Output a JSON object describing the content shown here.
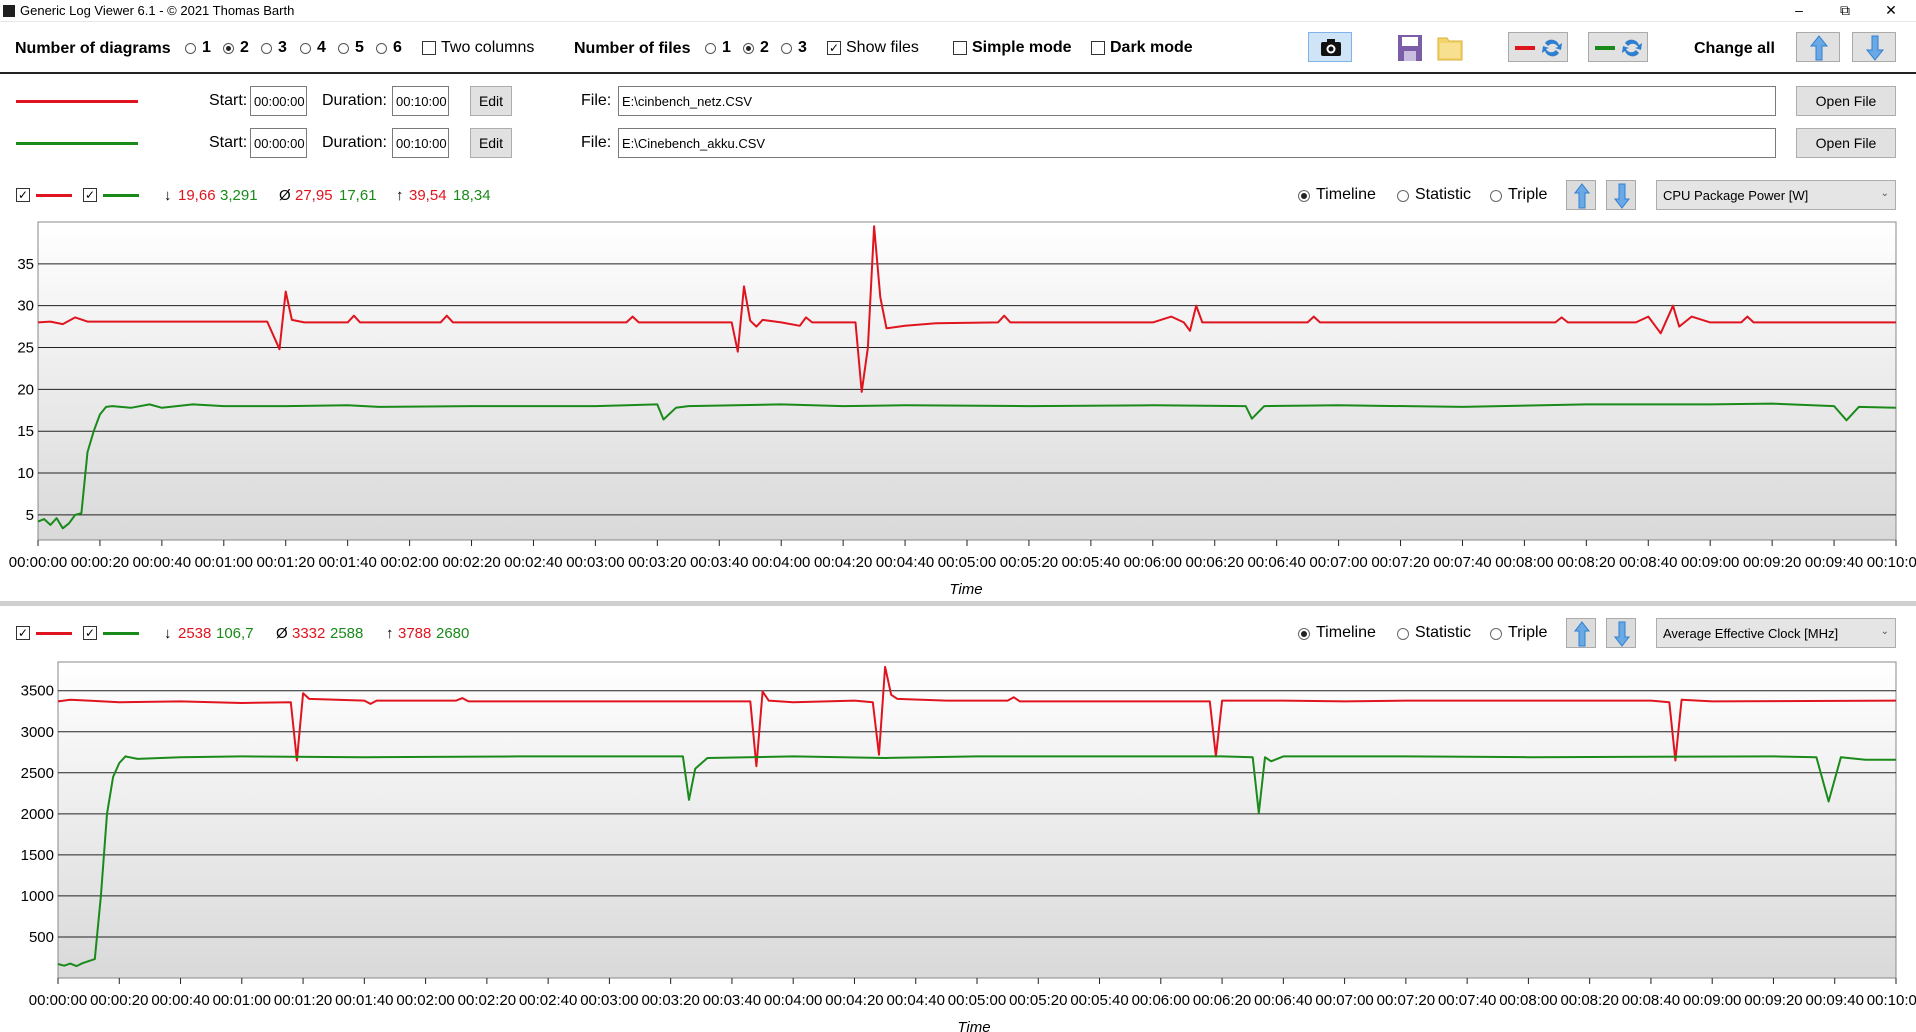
{
  "window": {
    "title": "Generic Log Viewer 6.1 - © 2021 Thomas Barth",
    "minimize_glyph": "–",
    "maximize_glyph": "⧉",
    "close_glyph": "✕"
  },
  "toolbar": {
    "num_diagrams_label": "Number of diagrams",
    "diagram_options": [
      "1",
      "2",
      "3",
      "4",
      "5",
      "6"
    ],
    "diagram_selected": "2",
    "two_columns_label": "Two columns",
    "two_columns_checked": false,
    "num_files_label": "Number of files",
    "file_options": [
      "1",
      "2",
      "3"
    ],
    "file_selected": "2",
    "show_files_label": "Show files",
    "show_files_checked": true,
    "simple_mode_label": "Simple mode",
    "dark_mode_label": "Dark mode",
    "change_all_label": "Change all",
    "icons": [
      "camera-icon",
      "save-icon",
      "folder-icon",
      "swap-red-icon",
      "swap-green-icon",
      "arrow-up-icon",
      "arrow-down-icon"
    ]
  },
  "files": [
    {
      "color": "#e0141e",
      "start_label": "Start:",
      "start": "00:00:00",
      "duration_label": "Duration:",
      "duration": "00:10:00",
      "edit_label": "Edit",
      "file_label": "File:",
      "path": "E:\\cinbench_netz.CSV",
      "open_label": "Open File"
    },
    {
      "color": "#1a8a1a",
      "start_label": "Start:",
      "start": "00:00:00",
      "duration_label": "Duration:",
      "duration": "00:10:00",
      "edit_label": "Edit",
      "file_label": "File:",
      "path": "E:\\Cinebench_akku.CSV",
      "open_label": "Open File"
    }
  ],
  "diagrams": [
    {
      "stats": {
        "min_red": "19,66",
        "min_green": "3,291",
        "avg_red": "27,95",
        "avg_green": "17,61",
        "max_red": "39,54",
        "max_green": "18,34"
      },
      "view_modes": [
        "Timeline",
        "Statistic",
        "Triple"
      ],
      "view_selected": "Timeline",
      "sensor": "CPU Package Power [W]",
      "xlabel": "Time"
    },
    {
      "stats": {
        "min_red": "2538",
        "min_green": "106,7",
        "avg_red": "3332",
        "avg_green": "2588",
        "max_red": "3788",
        "max_green": "2680"
      },
      "view_modes": [
        "Timeline",
        "Statistic",
        "Triple"
      ],
      "view_selected": "Timeline",
      "sensor": "Average Effective Clock [MHz]",
      "xlabel": "Time"
    }
  ],
  "stat_glyphs": {
    "min": "↓",
    "avg": "Ø",
    "max": "↑"
  },
  "chart_data": [
    {
      "type": "line",
      "xlabel": "Time",
      "ylabel": "",
      "ylim": [
        2,
        40
      ],
      "yticks": [
        5,
        10,
        15,
        20,
        25,
        30,
        35
      ],
      "xticks": [
        "00:00:00",
        "00:00:20",
        "00:00:40",
        "00:01:00",
        "00:01:20",
        "00:01:40",
        "00:02:00",
        "00:02:20",
        "00:02:40",
        "00:03:00",
        "00:03:20",
        "00:03:40",
        "00:04:00",
        "00:04:20",
        "00:04:40",
        "00:05:00",
        "00:05:20",
        "00:05:40",
        "00:06:00",
        "00:06:20",
        "00:06:40",
        "00:07:00",
        "00:07:20",
        "00:07:40",
        "00:08:00",
        "00:08:20",
        "00:08:40",
        "00:09:00",
        "00:09:20",
        "00:09:40",
        "00:10:00"
      ],
      "x_unit_seconds": [
        0,
        600
      ],
      "series": [
        {
          "color": "#e0141e",
          "points": [
            [
              0,
              28
            ],
            [
              4,
              28.1
            ],
            [
              8,
              27.8
            ],
            [
              12,
              28.6
            ],
            [
              16,
              28.1
            ],
            [
              30,
              28.1
            ],
            [
              50,
              28.1
            ],
            [
              74,
              28.1
            ],
            [
              78,
              24.8
            ],
            [
              80,
              31.7
            ],
            [
              82,
              28.3
            ],
            [
              86,
              28
            ],
            [
              100,
              28
            ],
            [
              102,
              28.8
            ],
            [
              104,
              28
            ],
            [
              130,
              28
            ],
            [
              132,
              28.8
            ],
            [
              134,
              28
            ],
            [
              190,
              28
            ],
            [
              192,
              28.7
            ],
            [
              194,
              28
            ],
            [
              224,
              28
            ],
            [
              226,
              24.5
            ],
            [
              228,
              32.3
            ],
            [
              230,
              28.2
            ],
            [
              232,
              27.5
            ],
            [
              234,
              28.3
            ],
            [
              240,
              28
            ],
            [
              246,
              27.6
            ],
            [
              248,
              28.6
            ],
            [
              250,
              28
            ],
            [
              264,
              28
            ],
            [
              266,
              19.7
            ],
            [
              268,
              25
            ],
            [
              270,
              39.5
            ],
            [
              272,
              31
            ],
            [
              274,
              27.3
            ],
            [
              280,
              27.6
            ],
            [
              290,
              27.9
            ],
            [
              310,
              28
            ],
            [
              312,
              28.8
            ],
            [
              314,
              28
            ],
            [
              360,
              28
            ],
            [
              366,
              28.7
            ],
            [
              370,
              28
            ],
            [
              372,
              27
            ],
            [
              374,
              30
            ],
            [
              376,
              28
            ],
            [
              410,
              28
            ],
            [
              412,
              28.7
            ],
            [
              414,
              28
            ],
            [
              490,
              28
            ],
            [
              492,
              28.6
            ],
            [
              494,
              28
            ],
            [
              516,
              28
            ],
            [
              520,
              28.7
            ],
            [
              524,
              26.7
            ],
            [
              528,
              30
            ],
            [
              530,
              27.5
            ],
            [
              534,
              28.7
            ],
            [
              540,
              28
            ],
            [
              550,
              28
            ],
            [
              552,
              28.7
            ],
            [
              554,
              28
            ],
            [
              600,
              28
            ]
          ]
        },
        {
          "color": "#1a8a1a",
          "points": [
            [
              0,
              4.2
            ],
            [
              2,
              4.5
            ],
            [
              4,
              3.8
            ],
            [
              6,
              4.6
            ],
            [
              8,
              3.4
            ],
            [
              10,
              4
            ],
            [
              12,
              5
            ],
            [
              14,
              5.2
            ],
            [
              16,
              12.5
            ],
            [
              18,
              15
            ],
            [
              20,
              17
            ],
            [
              22,
              17.9
            ],
            [
              24,
              18
            ],
            [
              30,
              17.8
            ],
            [
              36,
              18.2
            ],
            [
              40,
              17.8
            ],
            [
              50,
              18.2
            ],
            [
              60,
              18
            ],
            [
              80,
              18
            ],
            [
              100,
              18.1
            ],
            [
              110,
              17.9
            ],
            [
              140,
              18
            ],
            [
              180,
              18
            ],
            [
              200,
              18.2
            ],
            [
              202,
              16.4
            ],
            [
              206,
              17.8
            ],
            [
              210,
              18
            ],
            [
              240,
              18.2
            ],
            [
              260,
              18
            ],
            [
              280,
              18.1
            ],
            [
              320,
              18
            ],
            [
              360,
              18.1
            ],
            [
              390,
              18
            ],
            [
              392,
              16.5
            ],
            [
              396,
              18
            ],
            [
              420,
              18.1
            ],
            [
              460,
              17.9
            ],
            [
              500,
              18.2
            ],
            [
              540,
              18.2
            ],
            [
              560,
              18.3
            ],
            [
              580,
              18
            ],
            [
              584,
              16.3
            ],
            [
              588,
              17.9
            ],
            [
              600,
              17.8
            ]
          ]
        }
      ]
    },
    {
      "type": "line",
      "xlabel": "Time",
      "ylabel": "",
      "ylim": [
        0,
        3850
      ],
      "yticks": [
        500,
        1000,
        1500,
        2000,
        2500,
        3000,
        3500
      ],
      "xticks": [
        "00:00:00",
        "00:00:20",
        "00:00:40",
        "00:01:00",
        "00:01:20",
        "00:01:40",
        "00:02:00",
        "00:02:20",
        "00:02:40",
        "00:03:00",
        "00:03:20",
        "00:03:40",
        "00:04:00",
        "00:04:20",
        "00:04:40",
        "00:05:00",
        "00:05:20",
        "00:05:40",
        "00:06:00",
        "00:06:20",
        "00:06:40",
        "00:07:00",
        "00:07:20",
        "00:07:40",
        "00:08:00",
        "00:08:20",
        "00:08:40",
        "00:09:00",
        "00:09:20",
        "00:09:40",
        "00:10:00"
      ],
      "x_unit_seconds": [
        0,
        600
      ],
      "series": [
        {
          "color": "#e0141e",
          "points": [
            [
              0,
              3370
            ],
            [
              4,
              3390
            ],
            [
              10,
              3380
            ],
            [
              20,
              3360
            ],
            [
              40,
              3370
            ],
            [
              60,
              3350
            ],
            [
              76,
              3360
            ],
            [
              78,
              2650
            ],
            [
              80,
              3470
            ],
            [
              82,
              3400
            ],
            [
              100,
              3380
            ],
            [
              102,
              3340
            ],
            [
              104,
              3380
            ],
            [
              130,
              3380
            ],
            [
              132,
              3410
            ],
            [
              134,
              3370
            ],
            [
              226,
              3370
            ],
            [
              228,
              2580
            ],
            [
              230,
              3490
            ],
            [
              232,
              3380
            ],
            [
              240,
              3360
            ],
            [
              260,
              3380
            ],
            [
              266,
              3360
            ],
            [
              268,
              2720
            ],
            [
              270,
              3790
            ],
            [
              272,
              3450
            ],
            [
              274,
              3400
            ],
            [
              290,
              3380
            ],
            [
              310,
              3380
            ],
            [
              312,
              3420
            ],
            [
              314,
              3370
            ],
            [
              376,
              3370
            ],
            [
              378,
              2700
            ],
            [
              380,
              3380
            ],
            [
              400,
              3380
            ],
            [
              420,
              3370
            ],
            [
              440,
              3380
            ],
            [
              520,
              3380
            ],
            [
              526,
              3360
            ],
            [
              528,
              2650
            ],
            [
              530,
              3390
            ],
            [
              540,
              3370
            ],
            [
              600,
              3380
            ]
          ]
        },
        {
          "color": "#1a8a1a",
          "points": [
            [
              0,
              170
            ],
            [
              2,
              150
            ],
            [
              4,
              175
            ],
            [
              6,
              145
            ],
            [
              8,
              180
            ],
            [
              12,
              230
            ],
            [
              14,
              1000
            ],
            [
              16,
              2000
            ],
            [
              18,
              2450
            ],
            [
              20,
              2620
            ],
            [
              22,
              2700
            ],
            [
              26,
              2670
            ],
            [
              40,
              2690
            ],
            [
              60,
              2700
            ],
            [
              100,
              2690
            ],
            [
              150,
              2700
            ],
            [
              200,
              2700
            ],
            [
              204,
              2700
            ],
            [
              206,
              2170
            ],
            [
              208,
              2550
            ],
            [
              212,
              2680
            ],
            [
              240,
              2700
            ],
            [
              270,
              2680
            ],
            [
              300,
              2700
            ],
            [
              380,
              2700
            ],
            [
              390,
              2690
            ],
            [
              392,
              2010
            ],
            [
              394,
              2690
            ],
            [
              396,
              2640
            ],
            [
              400,
              2700
            ],
            [
              440,
              2700
            ],
            [
              480,
              2690
            ],
            [
              560,
              2700
            ],
            [
              574,
              2690
            ],
            [
              578,
              2150
            ],
            [
              582,
              2690
            ],
            [
              590,
              2660
            ],
            [
              600,
              2660
            ]
          ]
        }
      ]
    }
  ]
}
